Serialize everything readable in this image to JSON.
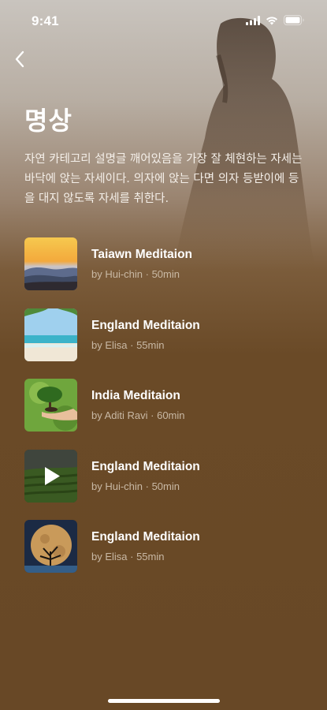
{
  "status_bar": {
    "time": "9:41"
  },
  "header": {
    "back_icon": "chevron-left-icon",
    "title": "명상",
    "description": "자연 카테고리 설명글 깨어있음을 가장 잘 체현하는 자세는 바닥에 앉는 자세이다. 의자에 앉는 다면 의자 등받이에 등을 대지 않도록  자세를 취한다."
  },
  "meditations": [
    {
      "title": "Taiawn Meditaion",
      "meta": "by Hui-chin · 50min",
      "thumb": "sunset-mountains"
    },
    {
      "title": "England Meditaion",
      "meta": "by Elisa · 55min",
      "thumb": "tropical-beach"
    },
    {
      "title": "India Meditaion",
      "meta": "by Aditi Ravi · 60min",
      "thumb": "tree-in-hand"
    },
    {
      "title": "England Meditaion",
      "meta": "by Hui-chin · 50min",
      "thumb": "tea-field-video",
      "icon": "play-icon"
    },
    {
      "title": "England Meditaion",
      "meta": "by Elisa · 55min",
      "thumb": "moon-tree"
    }
  ],
  "colors": {
    "background": "#6a4a27",
    "meta_text": "#c9b9a5"
  }
}
